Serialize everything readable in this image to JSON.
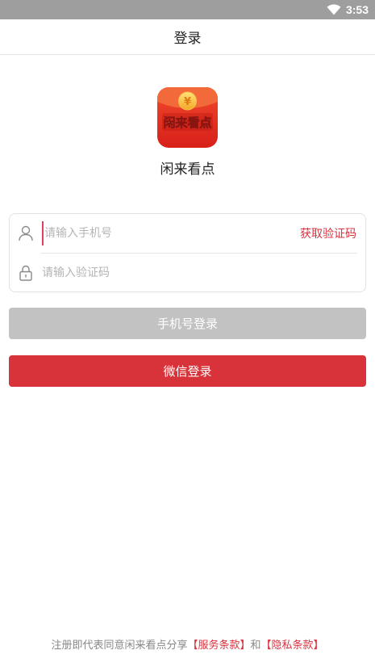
{
  "status_bar": {
    "time": "3:53",
    "wifi_icon": "wifi-icon"
  },
  "header": {
    "title": "登录"
  },
  "app": {
    "logo_text": "闲来看点",
    "name": "闲来看点"
  },
  "form": {
    "phone_placeholder": "请输入手机号",
    "phone_value": "",
    "code_placeholder": "请输入验证码",
    "code_value": "",
    "get_code_label": "获取验证码",
    "phone_icon": "user-icon",
    "code_icon": "lock-icon"
  },
  "buttons": {
    "phone_login": "手机号登录",
    "wechat_login": "微信登录"
  },
  "terms": {
    "prefix": "注册即代表同意闲来看点分享",
    "service_link": "【服务条款】",
    "conjunction": "和",
    "privacy_link": "【隐私条款】"
  },
  "colors": {
    "accent_red": "#d8333a",
    "disabled_gray": "#c2c2c2",
    "status_bar": "#9e9e9e"
  }
}
